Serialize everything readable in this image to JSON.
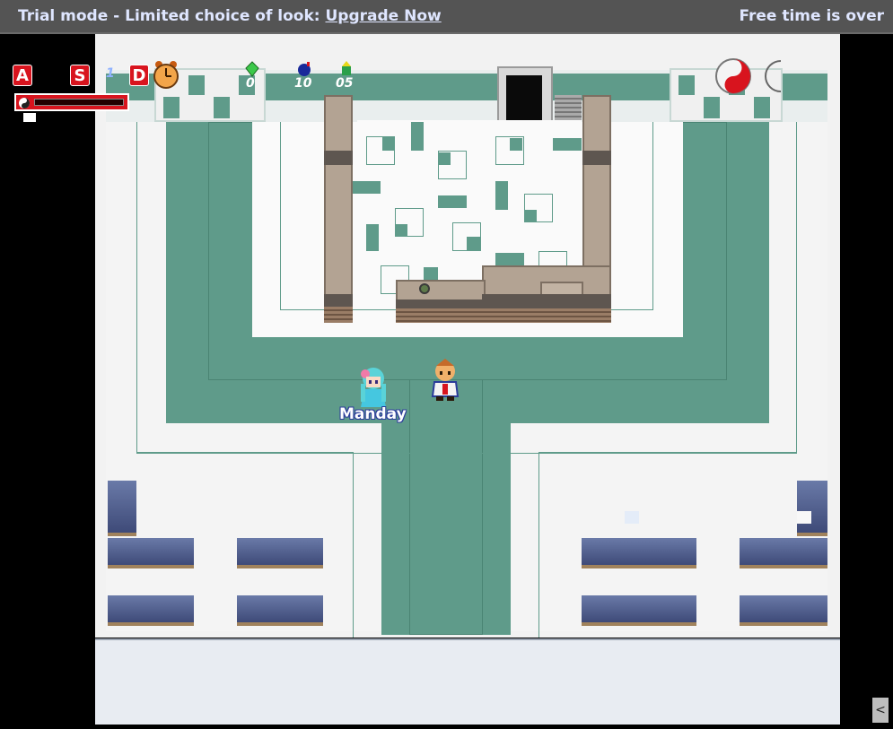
{
  "topbar": {
    "trial_text": "Trial mode - Limited choice of look: ",
    "upgrade_link": "Upgrade Now",
    "free_time_text": "Free time is over"
  },
  "hud": {
    "hotkey_a": "A",
    "hotkey_s": "S",
    "hotkey_d": "D",
    "s_count": "1",
    "gems_count": "0",
    "bombs_count": "10",
    "arrows_count": "05"
  },
  "player": {
    "name": "Manday"
  },
  "colors": {
    "floor_teal": "#5f9b8a",
    "hud_red": "#d8141e",
    "topbar_bg": "#545454"
  }
}
